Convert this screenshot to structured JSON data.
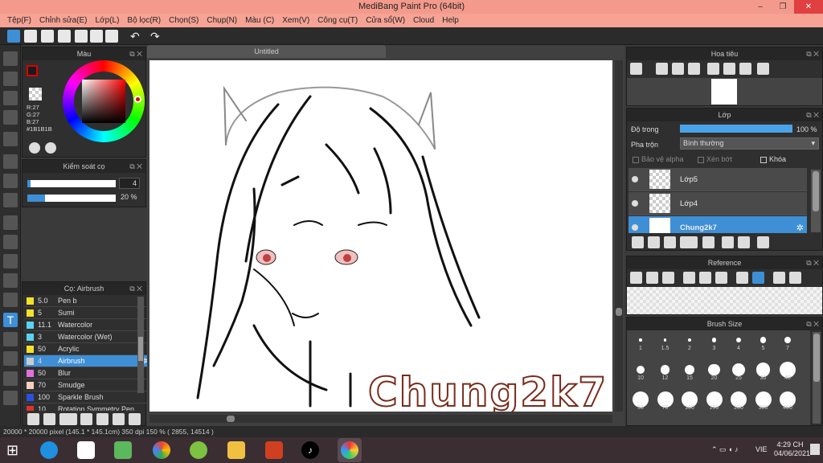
{
  "window": {
    "title": "MediBang Paint Pro (64bit)",
    "minimize": "–",
    "maximize": "❐",
    "close": "✕"
  },
  "menu": [
    "Tệp(F)",
    "Chỉnh sửa(E)",
    "Lớp(L)",
    "Bộ lọc(R)",
    "Chọn(S)",
    "Chụp(N)",
    "Màu (C)",
    "Xem(V)",
    "Công cụ(T)",
    "Cửa sổ(W)",
    "Cloud",
    "Help"
  ],
  "color_panel": {
    "title": "Màu",
    "r": "R:27",
    "g": "G:27",
    "b": "B:27",
    "hex": "#1B1B1B",
    "primary": "#1b1b1b"
  },
  "brush_control": {
    "title": "Kiểm soát cọ",
    "size": "4",
    "opacity": "20 %"
  },
  "brush_panel": {
    "title": "Cọ: Airbrush",
    "items": [
      {
        "size": "5.0",
        "name": "Pen b",
        "color": "#f2e22a"
      },
      {
        "size": "5",
        "name": "Sumi",
        "color": "#f2e22a"
      },
      {
        "size": "11.1",
        "name": "Watercolor",
        "color": "#5ad3f0"
      },
      {
        "size": "3",
        "name": "Watercolor (Wet)",
        "color": "#5ad3f0"
      },
      {
        "size": "50",
        "name": "Acrylic",
        "color": "#f2e22a"
      },
      {
        "size": "4",
        "name": "Airbrush",
        "color": "#cccccc"
      },
      {
        "size": "50",
        "name": "Blur",
        "color": "#e070e0"
      },
      {
        "size": "70",
        "name": "Smudge",
        "color": "#f4d0c0"
      },
      {
        "size": "100",
        "name": "Sparkle Brush",
        "color": "#2a50e0"
      },
      {
        "size": "10",
        "name": "Rotation Symmetry Pen",
        "color": "#e03030"
      }
    ]
  },
  "document": {
    "tab": "Untitled",
    "watermark": "Chung2k7"
  },
  "navigator": {
    "title": "Hoa tiêu"
  },
  "layer_panel": {
    "title": "Lớp",
    "opacity_label": "Độ trong",
    "opacity_value": "100 %",
    "opacity_fraction": 1.0,
    "blend_label": "Pha trộn",
    "blend_value": "Bình thường",
    "protect_alpha": "Bảo vệ alpha",
    "clipping": "Xén bớt",
    "lock": "Khóa",
    "layers": [
      {
        "name": "Lớp5"
      },
      {
        "name": "Lớp4"
      },
      {
        "name": "Chung2k7"
      }
    ]
  },
  "reference": {
    "title": "Reference"
  },
  "brush_size": {
    "title": "Brush Size",
    "sizes": [
      "1",
      "1.5",
      "2",
      "3",
      "4",
      "5",
      "7",
      "10",
      "12",
      "15",
      "20",
      "25",
      "30",
      "40",
      "50",
      "70",
      "100",
      "150",
      "200",
      "300",
      "400"
    ]
  },
  "status": {
    "text": "20000 * 20000 pixel   (145.1 * 145.1cm)   350 dpi   150 %   ( 2855, 14514 )"
  },
  "taskbar": {
    "lang": "VIE",
    "time": "4:29 CH",
    "date": "04/06/2021"
  }
}
